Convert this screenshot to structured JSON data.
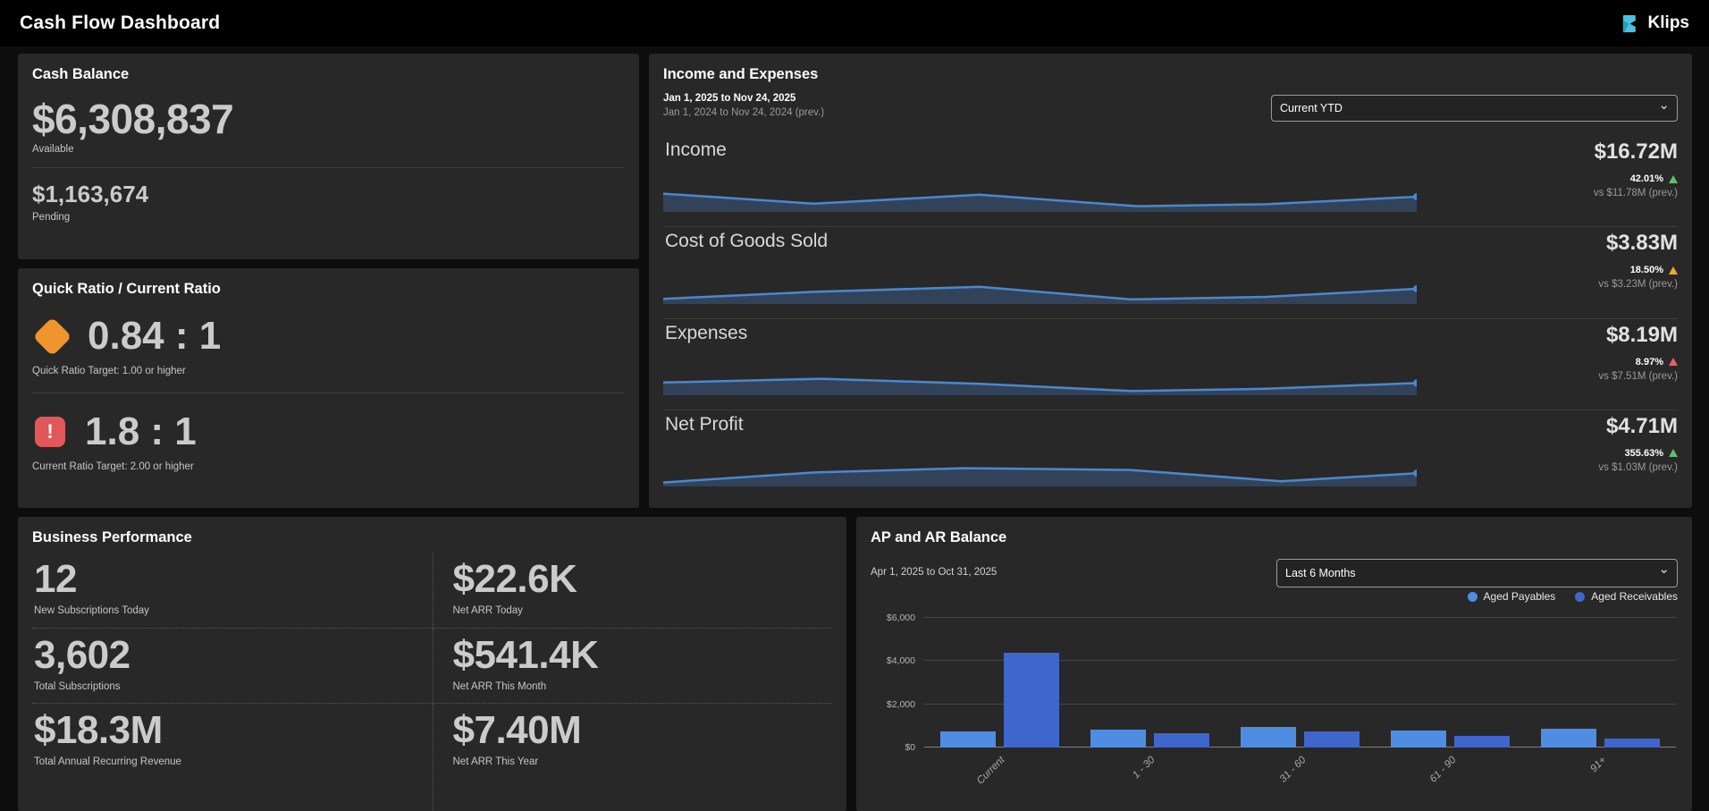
{
  "topbar": {
    "title": "Cash Flow Dashboard",
    "brand": "Klips"
  },
  "cash_balance": {
    "title": "Cash Balance",
    "available_value": "$6,308,837",
    "available_label": "Available",
    "pending_value": "$1,163,674",
    "pending_label": "Pending"
  },
  "ratios": {
    "title": "Quick Ratio / Current Ratio",
    "quick_value": "0.84 : 1",
    "quick_target": "Quick Ratio Target: 1.00 or higher",
    "quick_status_color": "#f0952e",
    "current_value": "1.8 : 1",
    "current_target": "Current Ratio Target: 2.00 or higher",
    "current_status_color": "#e25757"
  },
  "income_expenses": {
    "title": "Income and Expenses",
    "period": "Jan 1, 2025 to Nov 24, 2025",
    "period_prev": "Jan 1, 2024 to Nov 24, 2024 (prev.)",
    "range_selector": "Current YTD",
    "spark_color": "#4d87cd",
    "rows": [
      {
        "label": "Income",
        "value": "$16.72M",
        "pct": "42.01%",
        "prev": "vs $11.78M (prev.)",
        "trend_color": "#63bd6d",
        "spark_x": [
          0,
          20,
          42,
          63,
          80,
          100
        ],
        "spark_y": [
          0.62,
          0.22,
          0.58,
          0.12,
          0.2,
          0.5
        ]
      },
      {
        "label": "Cost of Goods Sold",
        "value": "$3.83M",
        "pct": "18.50%",
        "prev": "vs $3.23M (prev.)",
        "trend_color": "#f5a62c",
        "spark_x": [
          0,
          20,
          42,
          62,
          80,
          100
        ],
        "spark_y": [
          0.1,
          0.38,
          0.58,
          0.08,
          0.18,
          0.5
        ]
      },
      {
        "label": "Expenses",
        "value": "$8.19M",
        "pct": "8.97%",
        "prev": "vs $7.51M (prev.)",
        "trend_color": "#ec5f64",
        "spark_x": [
          0,
          21,
          42,
          62,
          80,
          100
        ],
        "spark_y": [
          0.4,
          0.55,
          0.35,
          0.06,
          0.15,
          0.38
        ]
      },
      {
        "label": "Net Profit",
        "value": "$4.71M",
        "pct": "355.63%",
        "prev": "vs $1.03M (prev.)",
        "trend_color": "#63bd6d",
        "spark_x": [
          0,
          20,
          40,
          62,
          82,
          100
        ],
        "spark_y": [
          0.05,
          0.45,
          0.62,
          0.55,
          0.1,
          0.42
        ]
      }
    ]
  },
  "business_performance": {
    "title": "Business Performance",
    "metrics": [
      {
        "value": "12",
        "label": "New Subscriptions Today"
      },
      {
        "value": "$22.6K",
        "label": "Net ARR Today"
      },
      {
        "value": "3,602",
        "label": "Total Subscriptions"
      },
      {
        "value": "$541.4K",
        "label": "Net ARR This Month"
      },
      {
        "value": "$18.3M",
        "label": "Total Annual Recurring Revenue"
      },
      {
        "value": "$7.40M",
        "label": "Net ARR This Year"
      }
    ]
  },
  "ap_ar": {
    "title": "AP and AR Balance",
    "period": "Apr 1, 2025 to Oct 31, 2025",
    "range_selector": "Last 6 Months",
    "chart_data": {
      "type": "bar",
      "categories": [
        "Current",
        "1 - 30",
        "31 - 60",
        "61 - 90",
        "91+"
      ],
      "series": [
        {
          "name": "Aged Payables",
          "color": "#4f8de2",
          "values": [
            750,
            830,
            950,
            770,
            880
          ]
        },
        {
          "name": "Aged Receivables",
          "color": "#3f66cb",
          "values": [
            4400,
            650,
            760,
            540,
            420
          ]
        }
      ],
      "ylim": [
        0,
        6000
      ],
      "ytick_values": [
        0,
        2000,
        4000,
        6000
      ],
      "ytick_labels": [
        "$0",
        "$2,000",
        "$4,000",
        "$6,000"
      ],
      "grid": true,
      "legend_position": "top-right"
    }
  }
}
